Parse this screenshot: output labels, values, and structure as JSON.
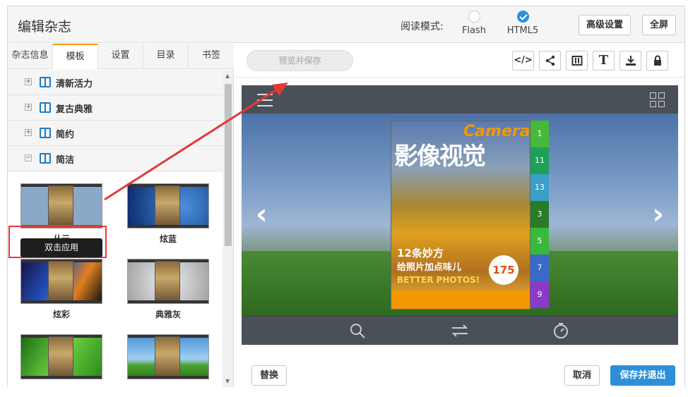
{
  "header": {
    "title": "编辑杂志",
    "read_mode_label": "阅读模式:",
    "mode_flash": "Flash",
    "mode_html5": "HTML5",
    "advanced_button": "高级设置",
    "fullscreen_button": "全屏"
  },
  "tabs": [
    "杂志信息",
    "模板",
    "设置",
    "目录",
    "书签"
  ],
  "tree": [
    {
      "label": "清新活力",
      "symbol": "+"
    },
    {
      "label": "复古典雅",
      "symbol": "+"
    },
    {
      "label": "简约",
      "symbol": "+"
    },
    {
      "label": "简洁",
      "symbol": "−"
    }
  ],
  "templates": [
    {
      "label": "丛云",
      "bg": "#8aa8c8"
    },
    {
      "label": "炫蓝",
      "bg": "#1b4f9a"
    },
    {
      "label": "炫彩",
      "bg": "#1a1040"
    },
    {
      "label": "典雅灰",
      "bg": "#c8c8c8"
    },
    {
      "label": "",
      "bg": "#3a9a2a"
    },
    {
      "label": "",
      "bg": "#5aa0d8"
    }
  ],
  "tooltip": "双击应用",
  "toolbar": {
    "preview_button": "预览并保存",
    "icons": [
      "code-icon",
      "share-icon",
      "book-icon",
      "text-icon",
      "download-icon",
      "lock-icon"
    ]
  },
  "magazine": {
    "brand": "Camera",
    "title": "影像视觉",
    "headline1": "12条妙方",
    "headline2": "给照片加点味儿",
    "headline_en": "BETTER PHOTOS!",
    "badge": "175"
  },
  "side_tabs": [
    {
      "label": "1",
      "color": "#46b83a"
    },
    {
      "label": "11",
      "color": "#1ea05a"
    },
    {
      "label": "13",
      "color": "#3aa0c8"
    },
    {
      "label": "3",
      "color": "#2a7a2a"
    },
    {
      "label": "5",
      "color": "#3ab83a"
    },
    {
      "label": "7",
      "color": "#3a6ac8"
    },
    {
      "label": "9",
      "color": "#8a3ac8"
    }
  ],
  "footer": {
    "replace_button": "替换",
    "cancel_button": "取消",
    "save_exit_button": "保存并退出"
  }
}
